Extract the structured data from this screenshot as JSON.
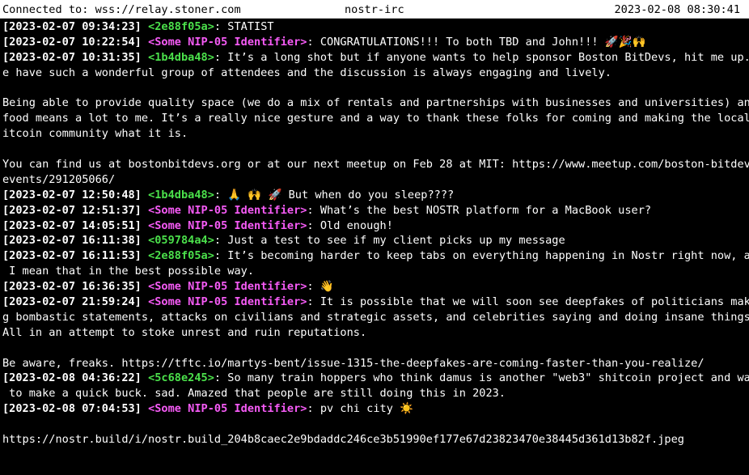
{
  "window": {
    "connection": "Connected to: wss://relay.stoner.com",
    "title": "nostr-irc",
    "clock": "2023-02-08 08:30:41"
  },
  "colors": {
    "background": "#000000",
    "status_bar": "#ffffff",
    "nick_hex": "#4be04b",
    "nick_nip05": "#f65bf6"
  },
  "lines": [
    {
      "ts": "[2023-02-07 09:34:23]",
      "nick": "<2e88f05a>",
      "nick_color": "green",
      "sep": ":",
      "msg": " STATIST"
    },
    {
      "ts": "[2023-02-07 10:22:54]",
      "nick": "<Some NIP-05 Identifier>",
      "nick_color": "magenta",
      "sep": ":",
      "msg": " CONGRATULATIONS!!! To both TBD and John!!! 🚀🎉🙌"
    },
    {
      "ts": "[2023-02-07 10:31:35]",
      "nick": "<1b4dba48>",
      "nick_color": "green",
      "sep": ":",
      "msg": " It’s a long shot but if anyone wants to help sponsor Boston BitDevs, hit me up. W"
    },
    {
      "ts": "",
      "nick": "",
      "nick_color": "",
      "sep": "",
      "msg": "e have such a wonderful group of attendees and the discussion is always engaging and lively."
    },
    {
      "ts": "",
      "nick": "",
      "nick_color": "",
      "sep": "",
      "msg": ""
    },
    {
      "ts": "",
      "nick": "",
      "nick_color": "",
      "sep": "",
      "msg": "Being able to provide quality space (we do a mix of rentals and partnerships with businesses and universities) and"
    },
    {
      "ts": "",
      "nick": "",
      "nick_color": "",
      "sep": "",
      "msg": "food means a lot to me. It’s a really nice gesture and a way to thank these folks for coming and making the local b"
    },
    {
      "ts": "",
      "nick": "",
      "nick_color": "",
      "sep": "",
      "msg": "itcoin community what it is."
    },
    {
      "ts": "",
      "nick": "",
      "nick_color": "",
      "sep": "",
      "msg": ""
    },
    {
      "ts": "",
      "nick": "",
      "nick_color": "",
      "sep": "",
      "msg": "You can find us at bostonbitdevs.org or at our next meetup on Feb 28 at MIT: https://www.meetup.com/boston-bitdevs/"
    },
    {
      "ts": "",
      "nick": "",
      "nick_color": "",
      "sep": "",
      "msg": "events/291205066/"
    },
    {
      "ts": "[2023-02-07 12:50:48]",
      "nick": "<1b4dba48>",
      "nick_color": "green",
      "sep": ":",
      "msg": " 🙏 🙌 🚀 But when do you sleep????"
    },
    {
      "ts": "[2023-02-07 12:51:37]",
      "nick": "<Some NIP-05 Identifier>",
      "nick_color": "magenta",
      "sep": ":",
      "msg": " What’s the best NOSTR platform for a MacBook user?"
    },
    {
      "ts": "[2023-02-07 14:05:51]",
      "nick": "<Some NIP-05 Identifier>",
      "nick_color": "magenta",
      "sep": ":",
      "msg": " Old enough!"
    },
    {
      "ts": "[2023-02-07 16:11:38]",
      "nick": "<059784a4>",
      "nick_color": "green",
      "sep": ":",
      "msg": " Just a test to see if my client picks up my message"
    },
    {
      "ts": "[2023-02-07 16:11:53]",
      "nick": "<2e88f05a>",
      "nick_color": "green",
      "sep": ":",
      "msg": " It’s becoming harder to keep tabs on everything happening in Nostr right now, and"
    },
    {
      "ts": "",
      "nick": "",
      "nick_color": "",
      "sep": "",
      "msg": " I mean that in the best possible way."
    },
    {
      "ts": "[2023-02-07 16:36:35]",
      "nick": "<Some NIP-05 Identifier>",
      "nick_color": "magenta",
      "sep": ":",
      "msg": " 👋"
    },
    {
      "ts": "[2023-02-07 21:59:24]",
      "nick": "<Some NIP-05 Identifier>",
      "nick_color": "magenta",
      "sep": ":",
      "msg": " It is possible that we will soon see deepfakes of politicians makin"
    },
    {
      "ts": "",
      "nick": "",
      "nick_color": "",
      "sep": "",
      "msg": "g bombastic statements, attacks on civilians and strategic assets, and celebrities saying and doing insane things."
    },
    {
      "ts": "",
      "nick": "",
      "nick_color": "",
      "sep": "",
      "msg": "All in an attempt to stoke unrest and ruin reputations."
    },
    {
      "ts": "",
      "nick": "",
      "nick_color": "",
      "sep": "",
      "msg": ""
    },
    {
      "ts": "",
      "nick": "",
      "nick_color": "",
      "sep": "",
      "msg": "Be aware, freaks. https://tftc.io/martys-bent/issue-1315-the-deepfakes-are-coming-faster-than-you-realize/"
    },
    {
      "ts": "[2023-02-08 04:36:22]",
      "nick": "<5c68e245>",
      "nick_color": "green",
      "sep": ":",
      "msg": " So many train hoppers who think damus is another \"web3\" shitcoin project and want"
    },
    {
      "ts": "",
      "nick": "",
      "nick_color": "",
      "sep": "",
      "msg": " to make a quick buck. sad. Amazed that people are still doing this in 2023."
    },
    {
      "ts": "[2023-02-08 07:04:53]",
      "nick": "<Some NIP-05 Identifier>",
      "nick_color": "magenta",
      "sep": ":",
      "msg": " pv chi city ☀️"
    },
    {
      "ts": "",
      "nick": "",
      "nick_color": "",
      "sep": "",
      "msg": ""
    },
    {
      "ts": "",
      "nick": "",
      "nick_color": "",
      "sep": "",
      "msg": "https://nostr.build/i/nostr.build_204b8caec2e9bdaddc246ce3b51990ef177e67d23823470e38445d361d13b82f.jpeg"
    }
  ]
}
